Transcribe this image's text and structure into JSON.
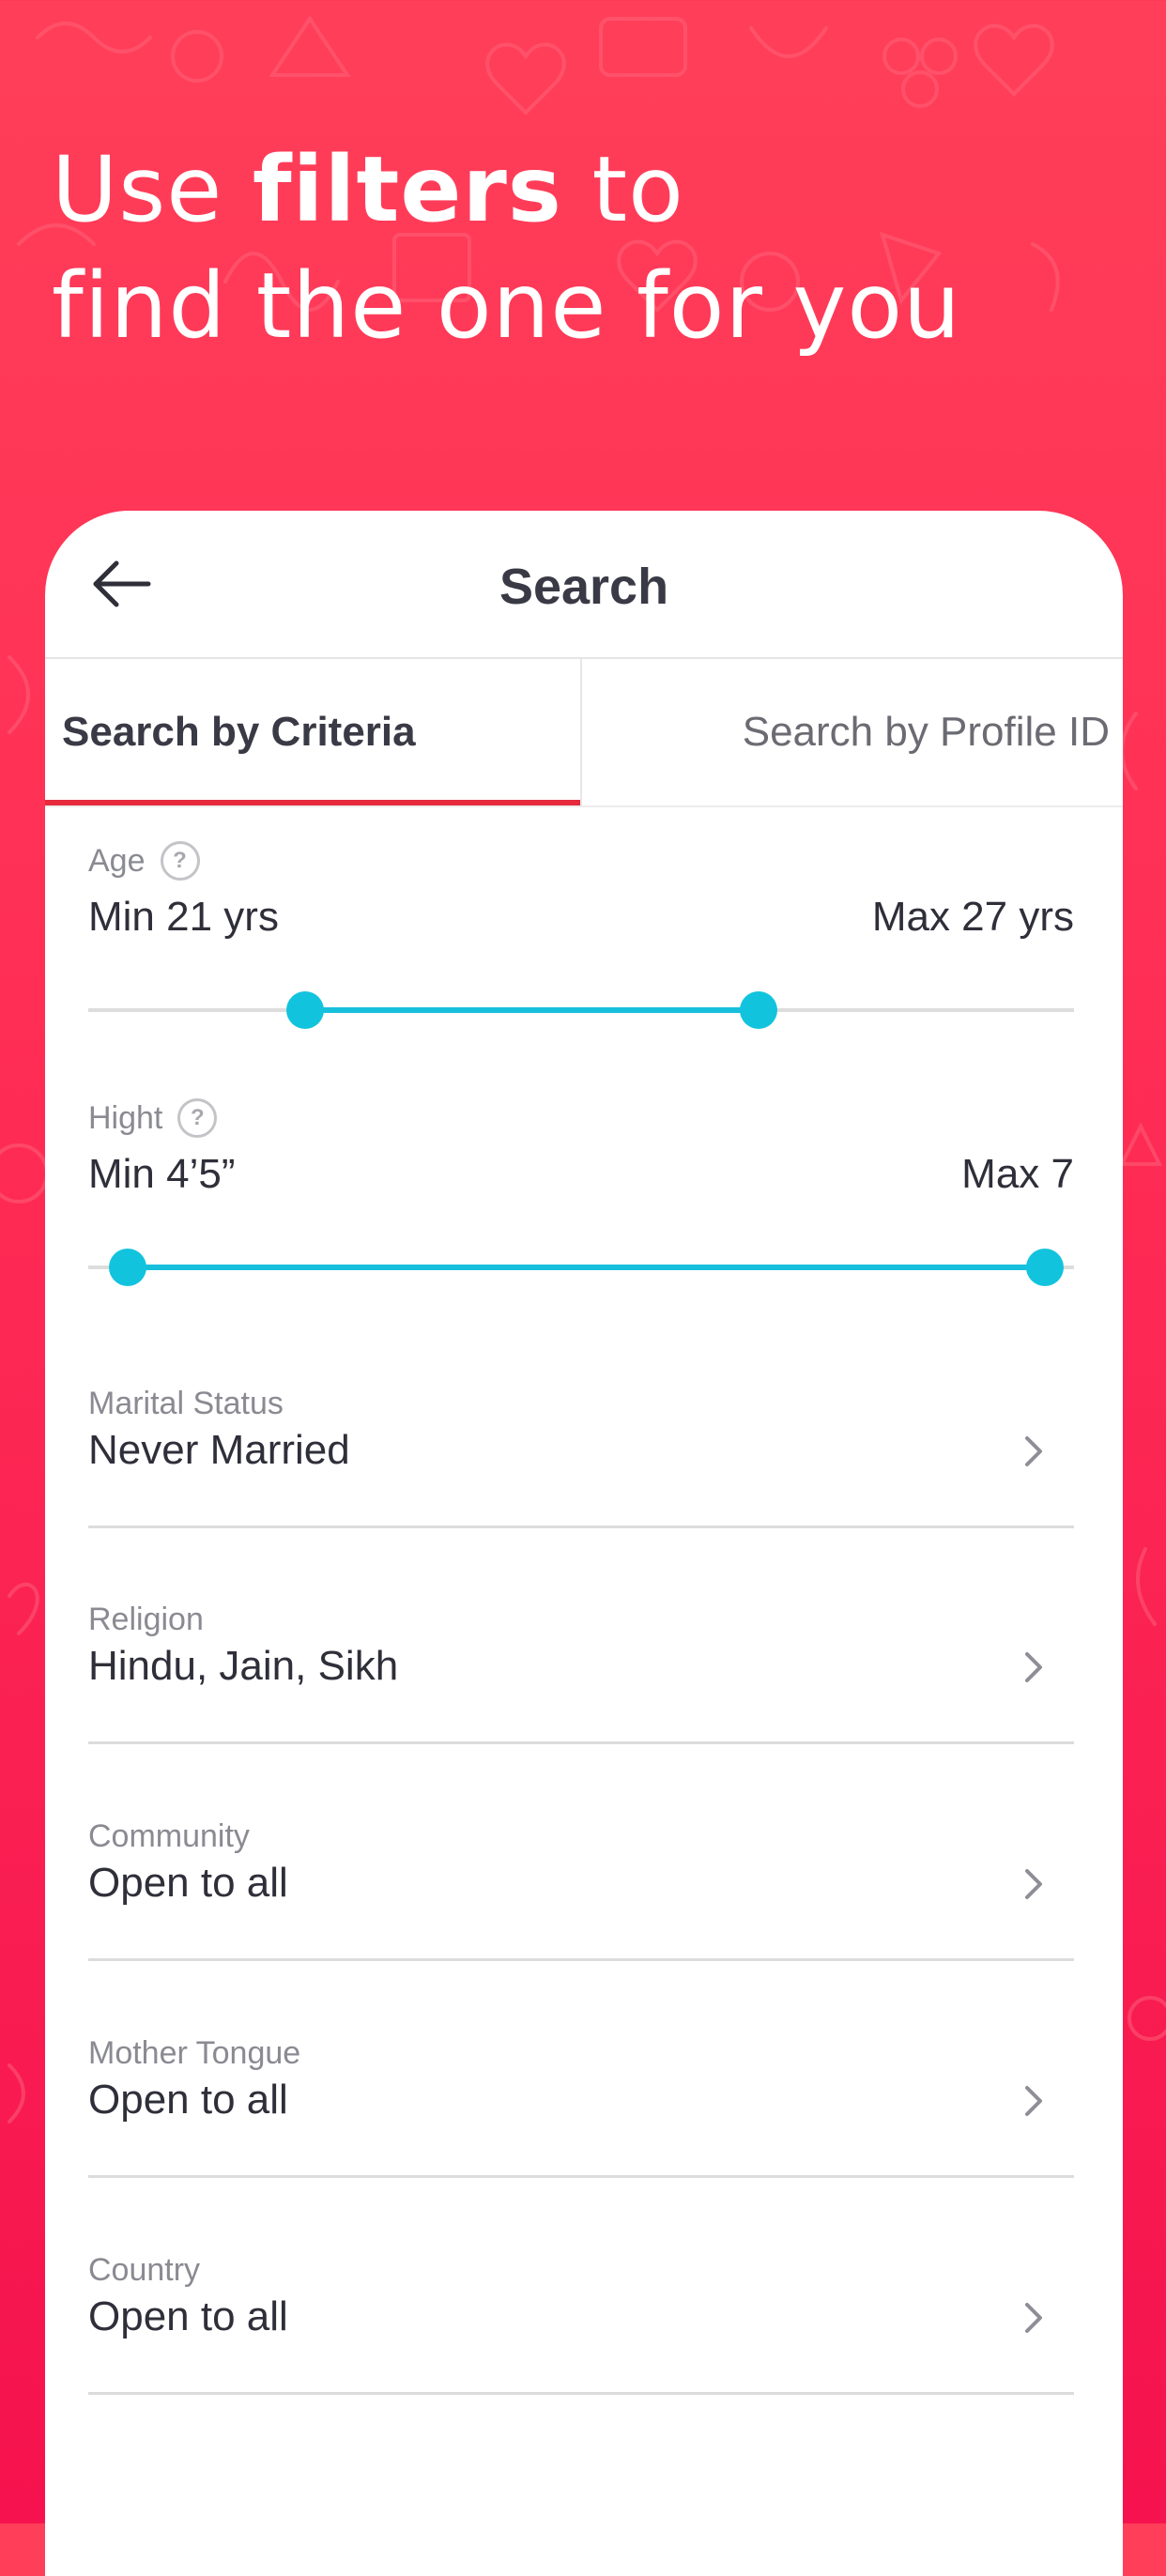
{
  "headline": {
    "pre": "Use ",
    "bold": "filters",
    "post": " to",
    "line2": "find the one for you"
  },
  "header": {
    "title": "Search",
    "back_icon": "arrow-left-icon"
  },
  "tabs": [
    {
      "label": "Search by Criteria",
      "selected": true
    },
    {
      "label": "Search by Profile ID",
      "selected": false
    }
  ],
  "age": {
    "label": "Age",
    "help_symbol": "?",
    "min_label": "Min 21 yrs",
    "max_label": "Max 27 yrs",
    "slider_low_fraction": 0.22,
    "slider_high_fraction": 0.68
  },
  "height": {
    "label": "Hight",
    "help_symbol": "?",
    "min_label": "Min 4’5”",
    "max_label": "Max 7",
    "slider_low_fraction": 0.04,
    "slider_high_fraction": 0.97
  },
  "filters": [
    {
      "label": "Marital Status",
      "value": "Never Married"
    },
    {
      "label": "Religion",
      "value": "Hindu, Jain, Sikh"
    },
    {
      "label": "Community",
      "value": "Open to all"
    },
    {
      "label": "Mother Tongue",
      "value": "Open to all"
    },
    {
      "label": "Country",
      "value": "Open to all"
    }
  ],
  "icons": {
    "help": "question-circle-icon",
    "chevron": "chevron-right-icon"
  },
  "colors": {
    "background_top": "#ff3f59",
    "background_bottom": "#f5124e",
    "tab_indicator": "#e52a3d",
    "slider_accent": "#12c3de"
  }
}
